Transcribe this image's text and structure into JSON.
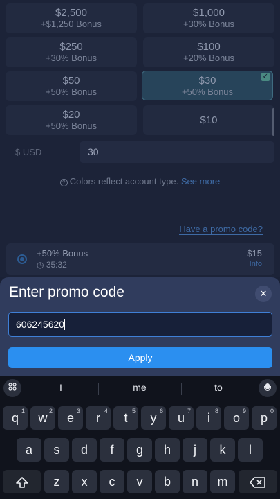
{
  "tiles": [
    {
      "amount": "$2,500",
      "bonus": "+$1,250 Bonus"
    },
    {
      "amount": "$1,000",
      "bonus": "+30% Bonus"
    },
    {
      "amount": "$250",
      "bonus": "+30% Bonus"
    },
    {
      "amount": "$100",
      "bonus": "+20% Bonus"
    },
    {
      "amount": "$50",
      "bonus": "+50% Bonus"
    },
    {
      "amount": "$30",
      "bonus": "+50% Bonus",
      "selected": true
    },
    {
      "amount": "$20",
      "bonus": "+50% Bonus"
    },
    {
      "amount": "$10",
      "bonus": ""
    }
  ],
  "amount_input": {
    "currency_label": "$ USD",
    "value": "30"
  },
  "colors_note": {
    "text": "Colors reflect account type.",
    "link": "See more"
  },
  "promo_link": "Have a promo code?",
  "bonus_card": {
    "title": "+50% Bonus",
    "timer": "35:32",
    "price": "$15",
    "info": "Info"
  },
  "promo_sheet": {
    "title": "Enter promo code",
    "input_value": "606245620",
    "apply_label": "Apply"
  },
  "keyboard": {
    "suggestions": [
      "I",
      "me",
      "to"
    ],
    "row1": [
      {
        "k": "q",
        "h": "1"
      },
      {
        "k": "w",
        "h": "2"
      },
      {
        "k": "e",
        "h": "3"
      },
      {
        "k": "r",
        "h": "4"
      },
      {
        "k": "t",
        "h": "5"
      },
      {
        "k": "y",
        "h": "6"
      },
      {
        "k": "u",
        "h": "7"
      },
      {
        "k": "i",
        "h": "8"
      },
      {
        "k": "o",
        "h": "9"
      },
      {
        "k": "p",
        "h": "0"
      }
    ],
    "row2": [
      "a",
      "s",
      "d",
      "f",
      "g",
      "h",
      "j",
      "k",
      "l"
    ],
    "row3": [
      "z",
      "x",
      "c",
      "v",
      "b",
      "n",
      "m"
    ]
  },
  "colors": {
    "accent": "#2b8ff0",
    "sheet_bg": "#303c5d",
    "link": "#3e6aa4"
  }
}
